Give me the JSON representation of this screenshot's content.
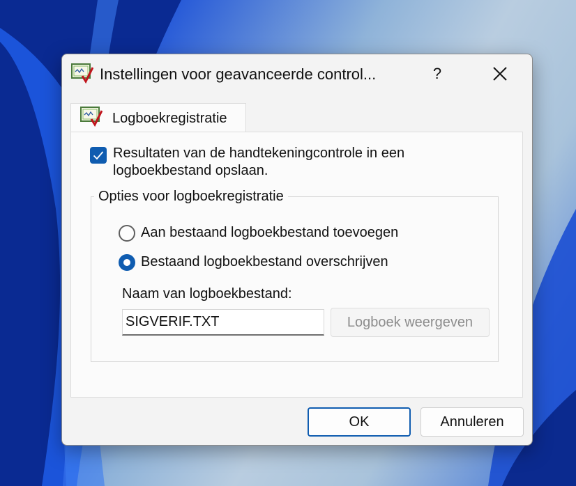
{
  "window": {
    "title": "Instellingen voor geavanceerde control...",
    "help_label": "?",
    "icon": "certificate-check-icon",
    "close_icon": "close-icon"
  },
  "tabs": [
    {
      "label": "Logboekregistratie",
      "icon": "certificate-check-icon",
      "selected": true
    }
  ],
  "panel": {
    "log_checkbox": {
      "label": "Resultaten van de handtekeningcontrole in een logboekbestand opslaan.",
      "checked": true
    },
    "group": {
      "legend": "Opties voor logboekregistratie",
      "options": [
        {
          "label": "Aan bestaand logboekbestand toevoegen",
          "selected": false
        },
        {
          "label": "Bestaand logboekbestand overschrijven",
          "selected": true
        }
      ],
      "filename_label": "Naam van logboekbestand:",
      "filename_value": "SIGVERIF.TXT",
      "view_log_label": "Logboek weergeven"
    }
  },
  "footer": {
    "ok_label": "OK",
    "cancel_label": "Annuleren"
  },
  "colors": {
    "accent": "#0f5cb0",
    "dialog_bg": "#f3f3f3",
    "disabled_text": "#8d8d8d"
  }
}
